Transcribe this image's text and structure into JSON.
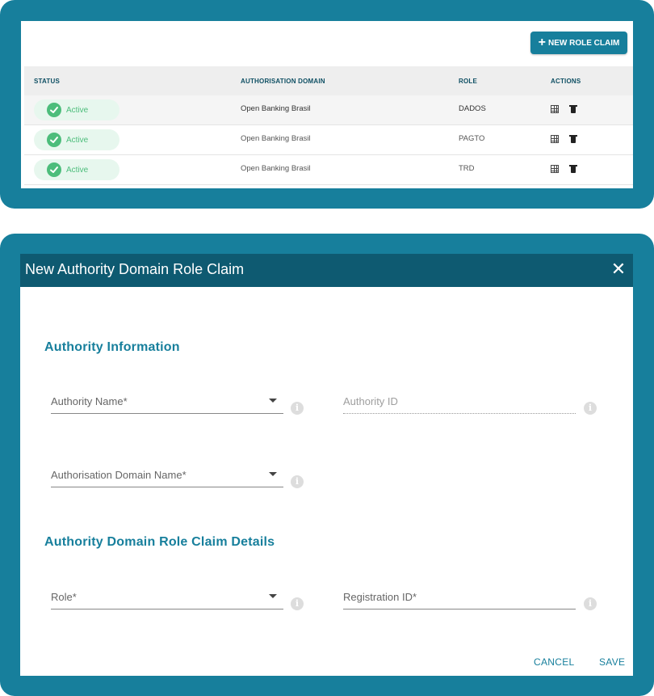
{
  "toolbar": {
    "new_role_claim_label": "NEW ROLE CLAIM"
  },
  "table": {
    "headers": {
      "status": "STATUS",
      "domain": "AUTHORISATION DOMAIN",
      "role": "ROLE",
      "actions": "ACTIONS"
    },
    "rows": [
      {
        "status": "Active",
        "domain": "Open Banking Brasil",
        "role": "DADOS"
      },
      {
        "status": "Active",
        "domain": "Open Banking Brasil",
        "role": "PAGTO"
      },
      {
        "status": "Active",
        "domain": "Open Banking Brasil",
        "role": "TRD"
      }
    ]
  },
  "dialog": {
    "title": "New Authority Domain Role Claim",
    "section1_title": "Authority Information",
    "section2_title": "Authority Domain Role Claim Details",
    "fields": {
      "authority_name": "Authority Name*",
      "authority_id": "Authority ID",
      "authorisation_domain_name": "Authorisation Domain Name*",
      "role": "Role*",
      "registration_id": "Registration ID*"
    },
    "info_glyph": "i",
    "close_glyph": "✕",
    "buttons": {
      "cancel": "CANCEL",
      "save": "SAVE"
    }
  },
  "colors": {
    "brand": "#177f9c",
    "header": "#0e5a71",
    "active_green": "#4cbd7b",
    "active_pill_bg": "#e7f7ee"
  },
  "icons": [
    "plus-icon",
    "check-circle-icon",
    "grid-icon",
    "trash-icon",
    "close-icon",
    "info-icon",
    "chevron-down-icon"
  ]
}
